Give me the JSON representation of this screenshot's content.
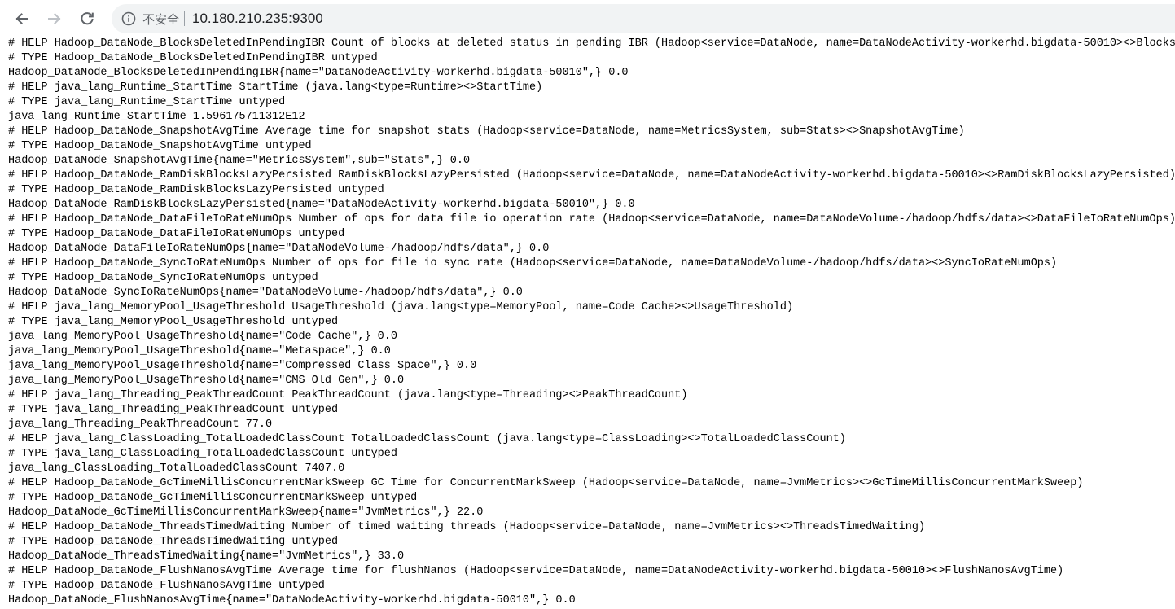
{
  "browser": {
    "security_label": "不安全",
    "url": "10.180.210.235:9300",
    "icons": [
      "back-arrow-icon",
      "forward-arrow-icon",
      "reload-icon",
      "info-icon"
    ]
  },
  "colors": {
    "toolbar_bg": "#ffffff",
    "omnibox_bg": "#f1f3f4",
    "text": "#000000",
    "icon_gray": "#5f6368"
  },
  "metrics_lines": [
    "# HELP Hadoop_DataNode_BlocksDeletedInPendingIBR Count of blocks at deleted status in pending IBR (Hadoop<service=DataNode, name=DataNodeActivity-workerhd.bigdata-50010><>BlocksDe",
    "# TYPE Hadoop_DataNode_BlocksDeletedInPendingIBR untyped",
    "Hadoop_DataNode_BlocksDeletedInPendingIBR{name=\"DataNodeActivity-workerhd.bigdata-50010\",} 0.0",
    "# HELP java_lang_Runtime_StartTime StartTime (java.lang<type=Runtime><>StartTime)",
    "# TYPE java_lang_Runtime_StartTime untyped",
    "java_lang_Runtime_StartTime 1.596175711312E12",
    "# HELP Hadoop_DataNode_SnapshotAvgTime Average time for snapshot stats (Hadoop<service=DataNode, name=MetricsSystem, sub=Stats><>SnapshotAvgTime)",
    "# TYPE Hadoop_DataNode_SnapshotAvgTime untyped",
    "Hadoop_DataNode_SnapshotAvgTime{name=\"MetricsSystem\",sub=\"Stats\",} 0.0",
    "# HELP Hadoop_DataNode_RamDiskBlocksLazyPersisted RamDiskBlocksLazyPersisted (Hadoop<service=DataNode, name=DataNodeActivity-workerhd.bigdata-50010><>RamDiskBlocksLazyPersisted)",
    "# TYPE Hadoop_DataNode_RamDiskBlocksLazyPersisted untyped",
    "Hadoop_DataNode_RamDiskBlocksLazyPersisted{name=\"DataNodeActivity-workerhd.bigdata-50010\",} 0.0",
    "# HELP Hadoop_DataNode_DataFileIoRateNumOps Number of ops for data file io operation rate (Hadoop<service=DataNode, name=DataNodeVolume-/hadoop/hdfs/data><>DataFileIoRateNumOps)",
    "# TYPE Hadoop_DataNode_DataFileIoRateNumOps untyped",
    "Hadoop_DataNode_DataFileIoRateNumOps{name=\"DataNodeVolume-/hadoop/hdfs/data\",} 0.0",
    "# HELP Hadoop_DataNode_SyncIoRateNumOps Number of ops for file io sync rate (Hadoop<service=DataNode, name=DataNodeVolume-/hadoop/hdfs/data><>SyncIoRateNumOps)",
    "# TYPE Hadoop_DataNode_SyncIoRateNumOps untyped",
    "Hadoop_DataNode_SyncIoRateNumOps{name=\"DataNodeVolume-/hadoop/hdfs/data\",} 0.0",
    "# HELP java_lang_MemoryPool_UsageThreshold UsageThreshold (java.lang<type=MemoryPool, name=Code Cache><>UsageThreshold)",
    "# TYPE java_lang_MemoryPool_UsageThreshold untyped",
    "java_lang_MemoryPool_UsageThreshold{name=\"Code Cache\",} 0.0",
    "java_lang_MemoryPool_UsageThreshold{name=\"Metaspace\",} 0.0",
    "java_lang_MemoryPool_UsageThreshold{name=\"Compressed Class Space\",} 0.0",
    "java_lang_MemoryPool_UsageThreshold{name=\"CMS Old Gen\",} 0.0",
    "# HELP java_lang_Threading_PeakThreadCount PeakThreadCount (java.lang<type=Threading><>PeakThreadCount)",
    "# TYPE java_lang_Threading_PeakThreadCount untyped",
    "java_lang_Threading_PeakThreadCount 77.0",
    "# HELP java_lang_ClassLoading_TotalLoadedClassCount TotalLoadedClassCount (java.lang<type=ClassLoading><>TotalLoadedClassCount)",
    "# TYPE java_lang_ClassLoading_TotalLoadedClassCount untyped",
    "java_lang_ClassLoading_TotalLoadedClassCount 7407.0",
    "# HELP Hadoop_DataNode_GcTimeMillisConcurrentMarkSweep GC Time for ConcurrentMarkSweep (Hadoop<service=DataNode, name=JvmMetrics><>GcTimeMillisConcurrentMarkSweep)",
    "# TYPE Hadoop_DataNode_GcTimeMillisConcurrentMarkSweep untyped",
    "Hadoop_DataNode_GcTimeMillisConcurrentMarkSweep{name=\"JvmMetrics\",} 22.0",
    "# HELP Hadoop_DataNode_ThreadsTimedWaiting Number of timed waiting threads (Hadoop<service=DataNode, name=JvmMetrics><>ThreadsTimedWaiting)",
    "# TYPE Hadoop_DataNode_ThreadsTimedWaiting untyped",
    "Hadoop_DataNode_ThreadsTimedWaiting{name=\"JvmMetrics\",} 33.0",
    "# HELP Hadoop_DataNode_FlushNanosAvgTime Average time for flushNanos (Hadoop<service=DataNode, name=DataNodeActivity-workerhd.bigdata-50010><>FlushNanosAvgTime)",
    "# TYPE Hadoop_DataNode_FlushNanosAvgTime untyped",
    "Hadoop_DataNode_FlushNanosAvgTime{name=\"DataNodeActivity-workerhd.bigdata-50010\",} 0.0"
  ]
}
